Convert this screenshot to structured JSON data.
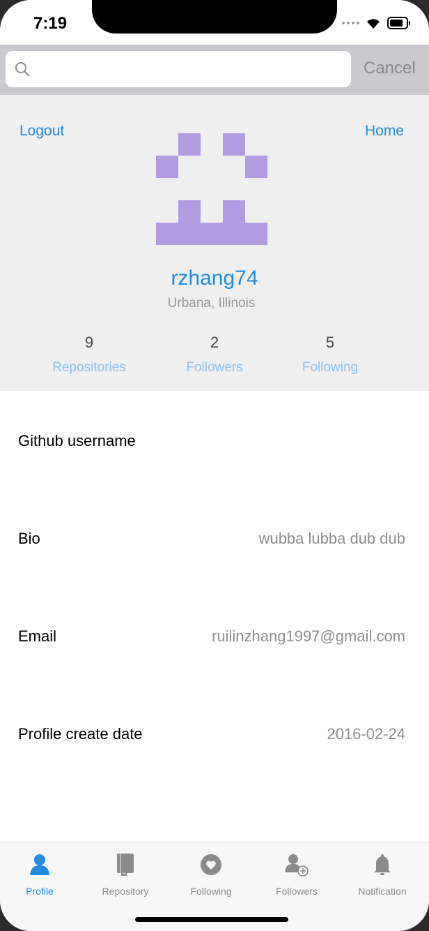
{
  "status": {
    "time": "7:19"
  },
  "search": {
    "placeholder": "",
    "cancel_label": "Cancel"
  },
  "header": {
    "logout_label": "Logout",
    "home_label": "Home",
    "username": "rzhang74",
    "location": "Urbana, Illinois",
    "avatar_color": "#b19ce2",
    "stats": [
      {
        "value": "9",
        "label": "Repositories"
      },
      {
        "value": "2",
        "label": "Followers"
      },
      {
        "value": "5",
        "label": "Following"
      }
    ]
  },
  "details": [
    {
      "key": "Github username",
      "value": ""
    },
    {
      "key": "Bio",
      "value": "wubba lubba dub dub"
    },
    {
      "key": "Email",
      "value": "ruilinzhang1997@gmail.com"
    },
    {
      "key": "Profile create date",
      "value": "2016-02-24"
    }
  ],
  "tabs": [
    {
      "label": "Profile",
      "icon": "person-icon",
      "active": true
    },
    {
      "label": "Repository",
      "icon": "book-icon",
      "active": false
    },
    {
      "label": "Following",
      "icon": "heart-icon",
      "active": false
    },
    {
      "label": "Followers",
      "icon": "add-person-icon",
      "active": false
    },
    {
      "label": "Notification",
      "icon": "bell-icon",
      "active": false
    }
  ],
  "colors": {
    "accent": "#1e8ce3",
    "stat_label": "#8fc2ef",
    "header_bg": "#efeff0",
    "searchbar_bg": "#c9c9ce"
  }
}
